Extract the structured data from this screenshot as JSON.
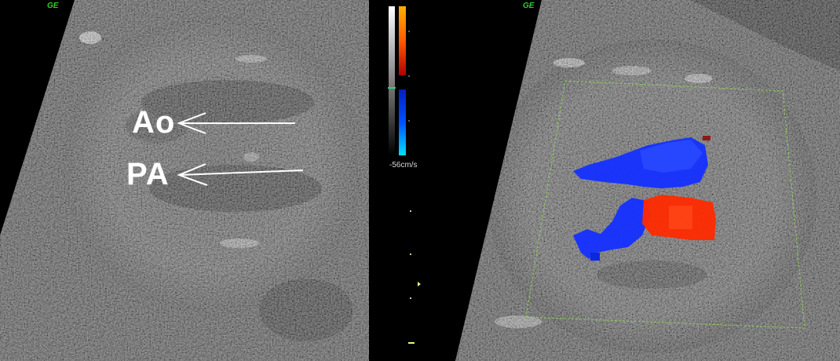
{
  "image": {
    "brand_left": "GE",
    "brand_right": "GE",
    "labels": {
      "ao": "Ao",
      "pa": "PA"
    },
    "color_scale": {
      "bottom_label": "-56cm/s",
      "positive_colors": [
        "#ffb000",
        "#ff5a00",
        "#c80000"
      ],
      "negative_colors": [
        "#0020c0",
        "#0050ff",
        "#00d8ff"
      ]
    },
    "colors": {
      "flow_blue": "#1430ff",
      "flow_red": "#ff2a00",
      "roi_box": "#8fcf5a",
      "brand": "#2fd12f"
    }
  }
}
